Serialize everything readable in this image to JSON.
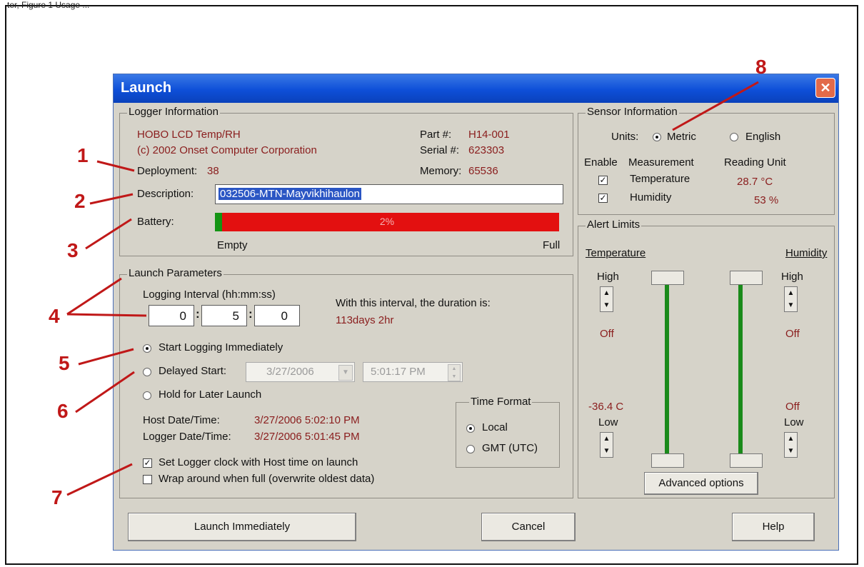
{
  "top_caption": "ter, Figure 1 Usage ...",
  "dialog": {
    "title": "Launch",
    "close_label": "✕"
  },
  "logger_info": {
    "group_label": "Logger Information",
    "name": "HOBO LCD Temp/RH",
    "copyright": "(c) 2002 Onset Computer Corporation",
    "deployment_label": "Deployment:",
    "deployment_value": "38",
    "part_label": "Part #:",
    "part_value": "H14-001",
    "serial_label": "Serial #:",
    "serial_value": "623303",
    "memory_label": "Memory:",
    "memory_value": "65536",
    "description_label": "Description:",
    "description_value": "032506-MTN-Mayvikhihaulon",
    "battery_label": "Battery:",
    "battery_percent": "2%",
    "battery_level": 0.02,
    "battery_empty": "Empty",
    "battery_full": "Full"
  },
  "launch_params": {
    "group_label": "Launch Parameters",
    "interval_label": "Logging Interval (hh:mm:ss)",
    "hh": "0",
    "mm": "5",
    "ss": "0",
    "duration_label": "With this interval, the duration is:",
    "duration_value": "113days 2hr",
    "start_immediately": "Start Logging Immediately",
    "delayed_start": "Delayed Start:",
    "delayed_date": "3/27/2006",
    "delayed_time": "5:01:17 PM",
    "hold_later": "Hold for Later Launch",
    "host_dt_label": "Host Date/Time:",
    "host_dt_value": "3/27/2006 5:02:10 PM",
    "logger_dt_label": "Logger Date/Time:",
    "logger_dt_value": "3/27/2006 5:01:45 PM",
    "time_format_label": "Time Format",
    "tf_local": "Local",
    "tf_gmt": "GMT (UTC)",
    "set_clock": "Set Logger clock with Host time on launch",
    "wrap_around": "Wrap around when full (overwrite oldest data)"
  },
  "sensor_info": {
    "group_label": "Sensor Information",
    "units_label": "Units:",
    "metric": "Metric",
    "english": "English",
    "enable_header": "Enable",
    "measurement_header": "Measurement",
    "reading_unit_header": "Reading Unit",
    "rows": [
      {
        "name": "Temperature",
        "reading": "28.7 °C"
      },
      {
        "name": "Humidity",
        "reading": "53 %"
      }
    ]
  },
  "alert_limits": {
    "group_label": "Alert Limits",
    "temperature": "Temperature",
    "humidity": "Humidity",
    "high": "High",
    "low": "Low",
    "temp_high_value": "Off",
    "temp_low_value": "-36.4 C",
    "hum_high_value": "Off",
    "hum_low_value": "Off",
    "advanced_options": "Advanced options"
  },
  "buttons": {
    "launch": "Launch Immediately",
    "cancel": "Cancel",
    "help": "Help"
  },
  "annotations": [
    "1",
    "2",
    "3",
    "4",
    "5",
    "6",
    "7",
    "8"
  ]
}
